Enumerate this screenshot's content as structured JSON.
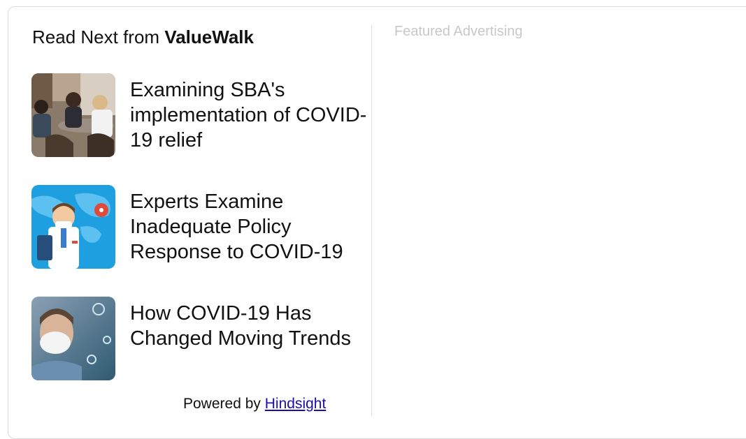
{
  "widget": {
    "heading_prefix": "Read Next from",
    "heading_brand": "ValueWalk",
    "articles": [
      {
        "title": "Examining SBA's implementation of COVID-19 relief",
        "thumb_icon": "students-cafe-photo"
      },
      {
        "title": "Experts Examine Inadequate Policy Response to COVID-19",
        "thumb_icon": "doctor-virus-illustration"
      },
      {
        "title": "How COVID-19 Has Changed Moving Trends",
        "thumb_icon": "masked-man-photo"
      }
    ],
    "powered_prefix": "Powered by",
    "powered_link": "Hindsight"
  },
  "ad": {
    "label": "Featured Advertising"
  },
  "colors": {
    "link": "#1a0dab",
    "ad_label": "#c8c8c8",
    "border": "#dcdcdc"
  }
}
